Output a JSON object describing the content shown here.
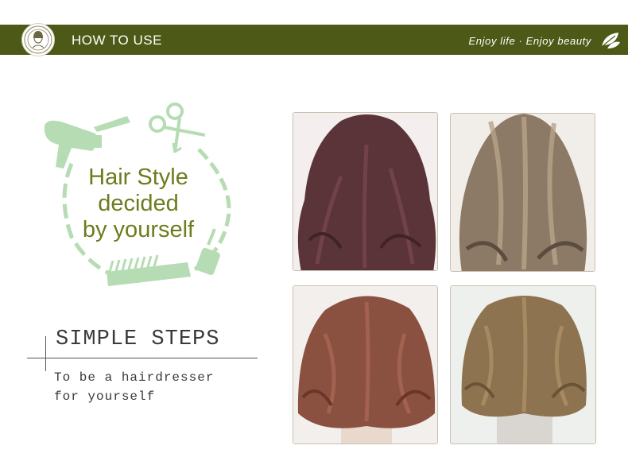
{
  "header": {
    "title": "HOW TO USE",
    "tagline": "Enjoy life · Enjoy beauty",
    "bar_color": "#4d5a17",
    "logo_icon": "woman-portrait-logo-icon",
    "leaf_icon": "leaf-icon"
  },
  "feature": {
    "line1": "Hair Style",
    "line2": "decided",
    "line3": "by yourself",
    "text_color": "#6b7d1d",
    "wreath_color": "#b5dcb3",
    "icons": [
      "hair-dryer-icon",
      "scissors-icon",
      "comb-icon",
      "round-brush-icon"
    ]
  },
  "steps": {
    "title": "SIMPLE STEPS",
    "line1": "To be a hairdresser",
    "line2": "for yourself"
  },
  "photos": [
    {
      "name": "burgundy-curly-hair-photo",
      "hair_color": "#5a3438"
    },
    {
      "name": "ash-brown-wavy-hair-photo",
      "hair_color": "#8c7a66"
    },
    {
      "name": "auburn-bob-hair-photo",
      "hair_color": "#8a5040"
    },
    {
      "name": "olive-brown-bob-hair-photo",
      "hair_color": "#8e7350"
    }
  ]
}
